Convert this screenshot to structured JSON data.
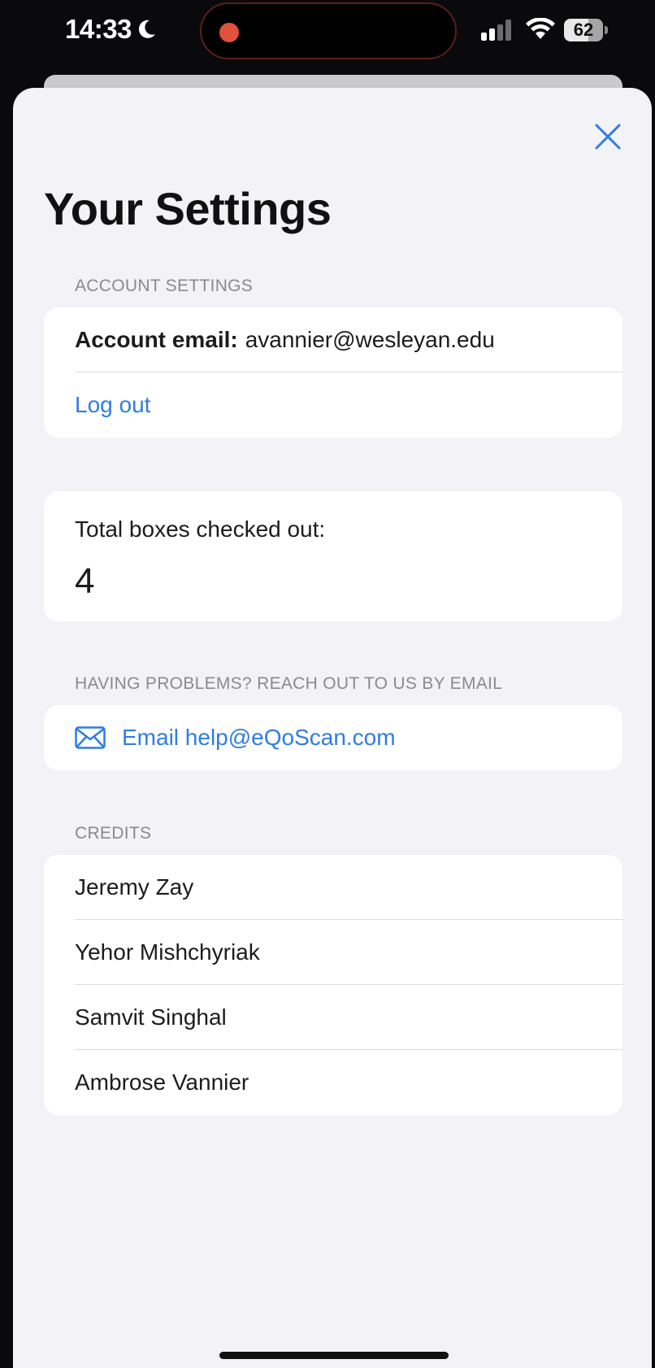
{
  "status_bar": {
    "time": "14:33",
    "battery": "62",
    "focus_icon": "moon-icon",
    "signal_icon": "cellular-signal-icon",
    "wifi_icon": "wifi-icon"
  },
  "sheet": {
    "title": "Your Settings",
    "close_icon": "close-icon"
  },
  "account_section": {
    "header": "ACCOUNT SETTINGS",
    "email_label": "Account email:",
    "email_value": "avannier@wesleyan.edu",
    "logout_label": "Log out"
  },
  "stats": {
    "label": "Total boxes checked out:",
    "value": "4"
  },
  "help_section": {
    "header": "HAVING PROBLEMS? REACH OUT TO US BY EMAIL",
    "email_link": "Email help@eQoScan.com",
    "icon": "envelope-icon"
  },
  "credits_section": {
    "header": "CREDITS",
    "names": [
      "Jeremy Zay",
      "Yehor Mishchyriak",
      "Samvit Singhal",
      "Ambrose Vannier"
    ]
  },
  "colors": {
    "accent": "#2f7de1",
    "sheet_background": "#f2f2f7",
    "card_background": "#ffffff",
    "section_header": "#8a8a8e"
  }
}
